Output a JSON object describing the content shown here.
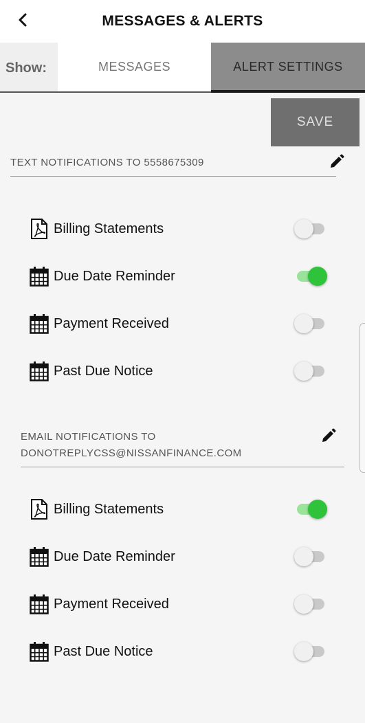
{
  "header": {
    "title": "MESSAGES & ALERTS",
    "back_icon": "chevron-left-icon"
  },
  "tabs": {
    "show_label": "Show:",
    "messages_label": "MESSAGES",
    "alert_settings_label": "ALERT SETTINGS",
    "active": "ALERT SETTINGS"
  },
  "save_label": "SAVE",
  "text_section": {
    "heading": "TEXT NOTIFICATIONS TO 5558675309",
    "edit_icon": "pencil-icon",
    "items": [
      {
        "label": "Billing Statements",
        "icon": "pdf-document-icon",
        "enabled": false
      },
      {
        "label": "Due Date Reminder",
        "icon": "calendar-icon",
        "enabled": true
      },
      {
        "label": "Payment Received",
        "icon": "calendar-icon",
        "enabled": false
      },
      {
        "label": "Past Due Notice",
        "icon": "calendar-icon",
        "enabled": false
      }
    ]
  },
  "email_section": {
    "heading_line1": "EMAIL NOTIFICATIONS TO",
    "heading_line2": "DONOTREPLYCSS@NISSANFINANCE.COM",
    "edit_icon": "pencil-icon",
    "items": [
      {
        "label": "Billing Statements",
        "icon": "pdf-document-icon",
        "enabled": true
      },
      {
        "label": "Due Date Reminder",
        "icon": "calendar-icon",
        "enabled": false
      },
      {
        "label": "Payment Received",
        "icon": "calendar-icon",
        "enabled": false
      },
      {
        "label": "Past Due Notice",
        "icon": "calendar-icon",
        "enabled": false
      }
    ]
  },
  "colors": {
    "toggle_on": "#2ec33b",
    "active_tab": "#8c8c8c",
    "save_button": "#6f6f6f"
  }
}
